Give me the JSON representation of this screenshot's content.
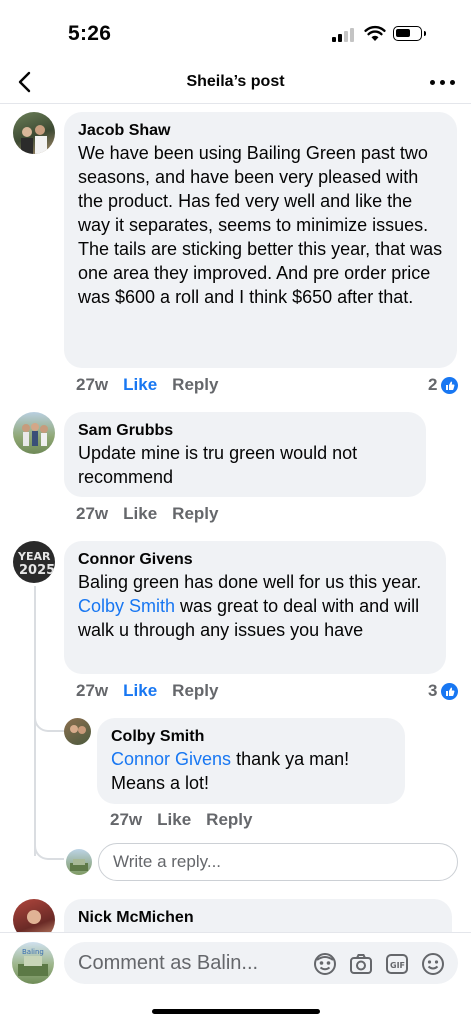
{
  "status_bar": {
    "time": "5:26"
  },
  "header": {
    "title": "Sheila’s post"
  },
  "comments": [
    {
      "name": "Jacob Shaw",
      "text": "We have been using Bailing Green past two seasons, and have been very pleased with the product. Has fed very well and like the way it separates, seems to minimize issues. The tails are sticking better this year, that was one area they improved. And pre order price was $600 a roll and I think $650 after that.",
      "time": "27w",
      "like": "Like",
      "reply": "Reply",
      "reactions": "2"
    },
    {
      "name": "Sam Grubbs",
      "text": "Update mine is tru green would not recommend",
      "time": "27w",
      "like": "Like",
      "reply": "Reply"
    },
    {
      "name": "Connor Givens",
      "text_before": "Baling green has done well for us this year. ",
      "tag": "Colby Smith",
      "text_after": " was great to deal with and will walk u through any issues you have",
      "time": "27w",
      "like": "Like",
      "reply": "Reply",
      "reactions": "3"
    },
    {
      "name": "Colby Smith",
      "tag": "Connor Givens",
      "text_after": " thank ya man! Means a lot!",
      "time": "27w",
      "like": "Like",
      "reply": "Reply"
    },
    {
      "name": "Nick McMichen"
    }
  ],
  "reply_box": {
    "placeholder": "Write a reply..."
  },
  "composer": {
    "placeholder": "Comment as Balin..."
  },
  "colors": {
    "accent": "#1877f2",
    "bubble": "#f0f2f5",
    "muted": "#65676b"
  }
}
